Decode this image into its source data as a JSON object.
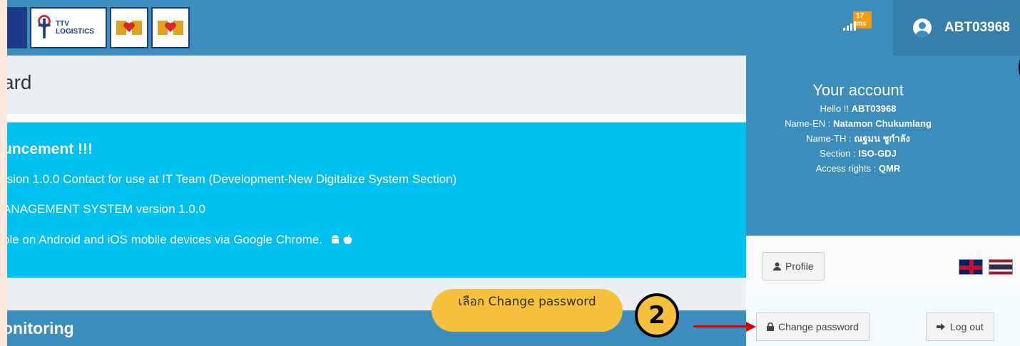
{
  "navbar": {
    "ping_label": "17 ms",
    "username": "ABT03968",
    "logos": [
      "TTV LOGISTICS"
    ]
  },
  "content": {
    "page_title": "ard",
    "announcement": {
      "title": "uncement !!!",
      "line1": "rsion 1.0.0 Contact for use at IT Team (Development-New Digitalize System Section)",
      "line2": "ANAGEMENT SYSTEM version 1.0.0",
      "line3": "ble on Android and iOS mobile devices via Google Chrome.",
      "icons": [
        "android-icon",
        "apple-icon"
      ]
    },
    "monitoring_title": "onitoring"
  },
  "account": {
    "title": "Your account",
    "hello_label": "Hello !! ",
    "hello_value": "ABT03968",
    "name_en_label": "Name-EN : ",
    "name_en_value": "Natamon Chukumlang",
    "name_th_label": "Name-TH : ",
    "name_th_value": "ณฐมน ชูกำลัง",
    "section_label": "Section : ",
    "section_value": "ISO-GDJ",
    "access_label": "Access rights : ",
    "access_value": "QMR",
    "profile_button": "Profile",
    "change_password_button": "Change password",
    "logout_button": "Log out"
  },
  "tutorial": {
    "callout_text": "เลือก Change password",
    "step_number": "2",
    "accent_color": "#f6c23e",
    "arrow_color": "#d80000"
  },
  "colors": {
    "navbar": "#3c8dbc",
    "user_menu": "#367fa9",
    "announcement": "#00c0ef",
    "page_bg": "#ecf0f5"
  }
}
